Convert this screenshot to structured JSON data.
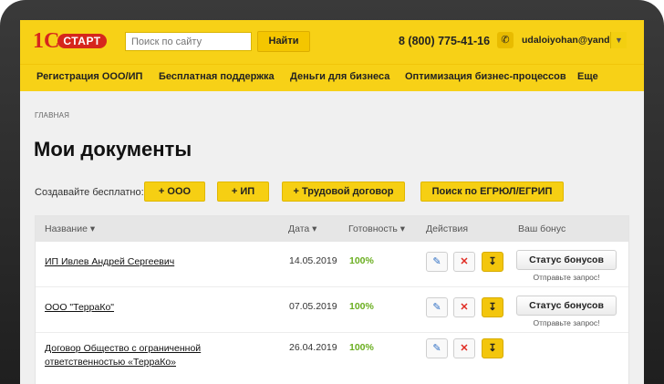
{
  "header": {
    "logo_one": "1С",
    "logo_text": "СТАРТ",
    "search_placeholder": "Поиск по сайту",
    "search_button": "Найти",
    "phone": "8 (800) 775-41-16",
    "user_email": "udaloiyohan@yand..."
  },
  "nav": {
    "items": [
      "Регистрация ООО/ИП",
      "Бесплатная поддержка",
      "Деньги для бизнеса",
      "Оптимизация бизнес-процессов",
      "Еще"
    ]
  },
  "breadcrumb": "ГЛАВНАЯ",
  "page_title": "Мои документы",
  "create": {
    "label": "Создавайте бесплатно:",
    "buttons": [
      "+ ООО",
      "+ ИП",
      "+ Трудовой договор",
      "Поиск по ЕГРЮЛ/ЕГРИП"
    ]
  },
  "table": {
    "headers": [
      "Название",
      "Дата",
      "Готовность",
      "Действия",
      "Ваш бонус"
    ],
    "rows": [
      {
        "name": "ИП Ивлев Андрей Сергеевич",
        "date": "14.05.2019",
        "ready": "100%",
        "bonus": "Статус бонусов",
        "note": "Отправьте запрос!"
      },
      {
        "name": "ООО \"ТерраКо\"",
        "date": "07.05.2019",
        "ready": "100%",
        "bonus": "Статус бонусов",
        "note": "Отправьте запрос!"
      },
      {
        "name": "Договор Общество с ограниченной ответственностью «ТерраКо»",
        "date": "26.04.2019",
        "ready": "100%",
        "bonus": "",
        "note": ""
      }
    ]
  },
  "colors": {
    "brand_yellow": "#f7d117",
    "brand_red": "#d6261c",
    "ready_green": "#6aae1f"
  }
}
